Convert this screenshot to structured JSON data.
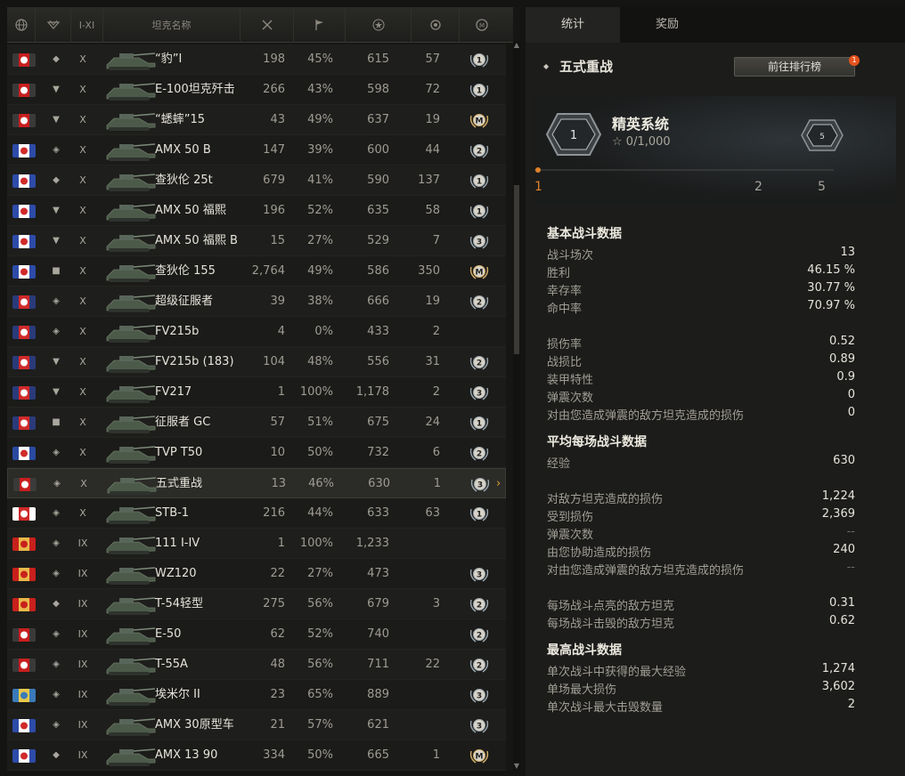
{
  "table": {
    "header": {
      "tier_label": "I-XI",
      "name_label": "坦克名称"
    },
    "rows": [
      {
        "nation": "germany",
        "type": "lt",
        "tier": "X",
        "name": "“豹”Ⅰ",
        "battles": "198",
        "winrate": "45%",
        "xp": "615",
        "damage": "57",
        "mark": "1",
        "mark_color": "#9aa6ae"
      },
      {
        "nation": "germany",
        "type": "td",
        "tier": "X",
        "name": "E-100坦克歼击",
        "battles": "266",
        "winrate": "43%",
        "xp": "598",
        "damage": "72",
        "mark": "1",
        "mark_color": "#9aa6ae"
      },
      {
        "nation": "germany",
        "type": "td",
        "tier": "X",
        "name": "“蟋蟀”15",
        "battles": "43",
        "winrate": "49%",
        "xp": "637",
        "damage": "19",
        "mark": "M",
        "mark_color": "#d6b06a"
      },
      {
        "nation": "france",
        "type": "ht",
        "tier": "X",
        "name": "AMX 50 B",
        "battles": "147",
        "winrate": "39%",
        "xp": "600",
        "damage": "44",
        "mark": "2",
        "mark_color": "#9aa6ae"
      },
      {
        "nation": "france",
        "type": "lt",
        "tier": "X",
        "name": "查狄伦 25t",
        "battles": "679",
        "winrate": "41%",
        "xp": "590",
        "damage": "137",
        "mark": "1",
        "mark_color": "#9aa6ae"
      },
      {
        "nation": "france",
        "type": "td",
        "tier": "X",
        "name": "AMX 50 福熙",
        "battles": "196",
        "winrate": "52%",
        "xp": "635",
        "damage": "58",
        "mark": "1",
        "mark_color": "#9aa6ae"
      },
      {
        "nation": "france",
        "type": "td",
        "tier": "X",
        "name": "AMX 50 福熙 B",
        "battles": "15",
        "winrate": "27%",
        "xp": "529",
        "damage": "7",
        "mark": "3",
        "mark_color": "#9aa6ae"
      },
      {
        "nation": "france",
        "type": "spg",
        "tier": "X",
        "name": "查狄伦 155",
        "battles": "2,764",
        "winrate": "49%",
        "xp": "586",
        "damage": "350",
        "mark": "M",
        "mark_color": "#d6b06a"
      },
      {
        "nation": "uk",
        "type": "ht",
        "tier": "X",
        "name": "超级征服者",
        "battles": "39",
        "winrate": "38%",
        "xp": "666",
        "damage": "19",
        "mark": "2",
        "mark_color": "#9aa6ae"
      },
      {
        "nation": "uk",
        "type": "ht",
        "tier": "X",
        "name": "FV215b",
        "battles": "4",
        "winrate": "0%",
        "xp": "433",
        "damage": "2",
        "mark": "",
        "mark_color": "#9aa6ae"
      },
      {
        "nation": "uk",
        "type": "td",
        "tier": "X",
        "name": "FV215b (183)",
        "battles": "104",
        "winrate": "48%",
        "xp": "556",
        "damage": "31",
        "mark": "2",
        "mark_color": "#9aa6ae"
      },
      {
        "nation": "uk",
        "type": "td",
        "tier": "X",
        "name": "FV217",
        "battles": "1",
        "winrate": "100%",
        "xp": "1,178",
        "damage": "2",
        "mark": "3",
        "mark_color": "#9aa6ae"
      },
      {
        "nation": "uk",
        "type": "spg",
        "tier": "X",
        "name": "征服者 GC",
        "battles": "57",
        "winrate": "51%",
        "xp": "675",
        "damage": "24",
        "mark": "1",
        "mark_color": "#9aa6ae"
      },
      {
        "nation": "czech",
        "type": "mt",
        "tier": "X",
        "name": "TVP T50",
        "battles": "10",
        "winrate": "50%",
        "xp": "732",
        "damage": "6",
        "mark": "2",
        "mark_color": "#9aa6ae"
      },
      {
        "nation": "germany",
        "type": "ht",
        "tier": "X",
        "name": "五式重战",
        "battles": "13",
        "winrate": "46%",
        "xp": "630",
        "damage": "1",
        "mark": "3",
        "mark_color": "#9aa6ae",
        "selected": true
      },
      {
        "nation": "japan",
        "type": "mt",
        "tier": "X",
        "name": "STB-1",
        "battles": "216",
        "winrate": "44%",
        "xp": "633",
        "damage": "63",
        "mark": "1",
        "mark_color": "#9aa6ae"
      },
      {
        "nation": "china",
        "type": "ht",
        "tier": "IX",
        "name": "111 I-IV",
        "battles": "1",
        "winrate": "100%",
        "xp": "1,233",
        "damage": "",
        "mark": "",
        "mark_color": "#9aa6ae"
      },
      {
        "nation": "china",
        "type": "mt",
        "tier": "IX",
        "name": "WZ120",
        "battles": "22",
        "winrate": "27%",
        "xp": "473",
        "damage": "",
        "mark": "3",
        "mark_color": "#9aa6ae"
      },
      {
        "nation": "ussr",
        "type": "lt",
        "tier": "IX",
        "name": "T-54轻型",
        "battles": "275",
        "winrate": "56%",
        "xp": "679",
        "damage": "3",
        "mark": "2",
        "mark_color": "#9aa6ae"
      },
      {
        "nation": "germany",
        "type": "mt",
        "tier": "IX",
        "name": "E-50",
        "battles": "62",
        "winrate": "52%",
        "xp": "740",
        "damage": "",
        "mark": "2",
        "mark_color": "#9aa6ae"
      },
      {
        "nation": "germany",
        "type": "mt",
        "tier": "IX",
        "name": "T-55A",
        "battles": "48",
        "winrate": "56%",
        "xp": "711",
        "damage": "22",
        "mark": "2",
        "mark_color": "#9aa6ae"
      },
      {
        "nation": "sweden",
        "type": "ht",
        "tier": "IX",
        "name": "埃米尔 II",
        "battles": "23",
        "winrate": "65%",
        "xp": "889",
        "damage": "",
        "mark": "3",
        "mark_color": "#9aa6ae"
      },
      {
        "nation": "france",
        "type": "mt",
        "tier": "IX",
        "name": "AMX 30原型车",
        "battles": "21",
        "winrate": "57%",
        "xp": "621",
        "damage": "",
        "mark": "3",
        "mark_color": "#9aa6ae"
      },
      {
        "nation": "france",
        "type": "lt",
        "tier": "IX",
        "name": "AMX 13 90",
        "battles": "334",
        "winrate": "50%",
        "xp": "665",
        "damage": "1",
        "mark": "M",
        "mark_color": "#d6b06a"
      }
    ]
  },
  "panel": {
    "tabs": [
      {
        "label": "统计",
        "active": true
      },
      {
        "label": "奖励",
        "active": false
      }
    ],
    "tank_title": "五式重战",
    "leaderboard_button": "前往排行榜",
    "leaderboard_badge": "1",
    "elite": {
      "badge_level": "1",
      "title": "精英系统",
      "progress": "0/1,000",
      "next_level": "5",
      "scale_labels": [
        "1",
        "2",
        "5"
      ]
    },
    "basic": {
      "heading": "基本战斗数据",
      "items": [
        {
          "label": "战斗场次",
          "value": "13"
        },
        {
          "label": "胜利",
          "value": "46.15 %"
        },
        {
          "label": "幸存率",
          "value": "30.77 %"
        },
        {
          "label": "命中率",
          "value": "70.97 %"
        }
      ]
    },
    "ratios": {
      "items": [
        {
          "label": "损伤率",
          "value": "0.52"
        },
        {
          "label": "战损比",
          "value": "0.89"
        },
        {
          "label": "装甲特性",
          "value": "0.9"
        },
        {
          "label": "弹震次数",
          "value": "0"
        },
        {
          "label": "对由您造成弹震的敌方坦克造成的损伤",
          "value": "0"
        }
      ]
    },
    "average": {
      "heading": "平均每场战斗数据",
      "items": [
        {
          "label": "经验",
          "value": "630"
        }
      ]
    },
    "damage": {
      "items": [
        {
          "label": "对敌方坦克造成的损伤",
          "value": "1,224"
        },
        {
          "label": "受到损伤",
          "value": "2,369"
        },
        {
          "label": "弹震次数",
          "value": "--"
        },
        {
          "label": "由您协助造成的损伤",
          "value": "240"
        },
        {
          "label": "对由您造成弹震的敌方坦克造成的损伤",
          "value": "--"
        }
      ]
    },
    "kills": {
      "items": [
        {
          "label": "每场战斗点亮的敌方坦克",
          "value": "0.31"
        },
        {
          "label": "每场战斗击毁的敌方坦克",
          "value": "0.62"
        }
      ]
    },
    "best": {
      "heading": "最高战斗数据",
      "items": [
        {
          "label": "单次战斗中获得的最大经验",
          "value": "1,274"
        },
        {
          "label": "单场最大损伤",
          "value": "3,602"
        },
        {
          "label": "单次战斗最大击毁数量",
          "value": "2"
        }
      ]
    }
  }
}
